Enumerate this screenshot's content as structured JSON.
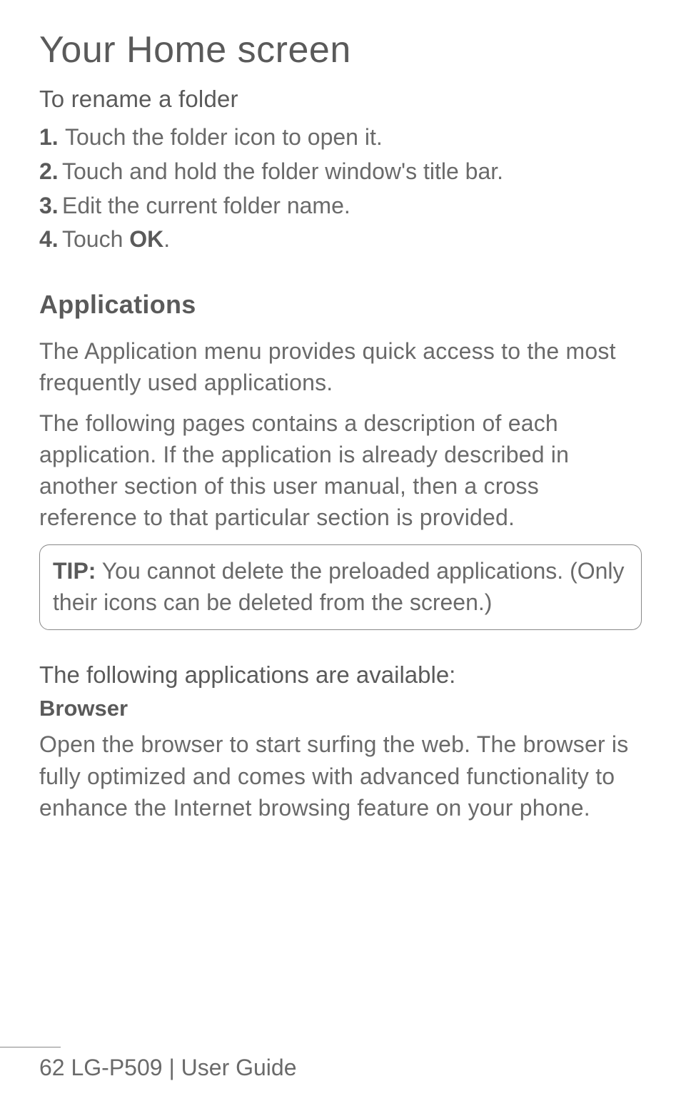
{
  "title": "Your Home screen",
  "rename_heading": "To rename a folder",
  "steps": {
    "n1": "1.",
    "t1": "Touch the folder icon to open it.",
    "n2": "2.",
    "t2": "Touch and hold the folder window's title bar.",
    "n3": "3.",
    "t3": "Edit the current folder name.",
    "n4": "4.",
    "t4_a": "Touch ",
    "t4_b": "OK",
    "t4_c": "."
  },
  "apps_heading": "Applications",
  "apps_para1": "The Application menu provides quick access to the most frequently used applications.",
  "apps_para2": "The following pages contains a description of each application. If the application is already described in another section of this user manual, then a cross reference to that particular section is provided.",
  "tip_label": "TIP:",
  "tip_body": " You cannot delete the preloaded applications. (Only their icons can be deleted from the screen.)",
  "available_heading": "The following applications are available:",
  "browser_label": "Browser",
  "browser_para": "Open the browser to start surfing the web. The browser is fully optimized and comes with advanced functionality to enhance the Internet browsing feature on your phone.",
  "footer": "62   LG-P509   |  User Guide"
}
